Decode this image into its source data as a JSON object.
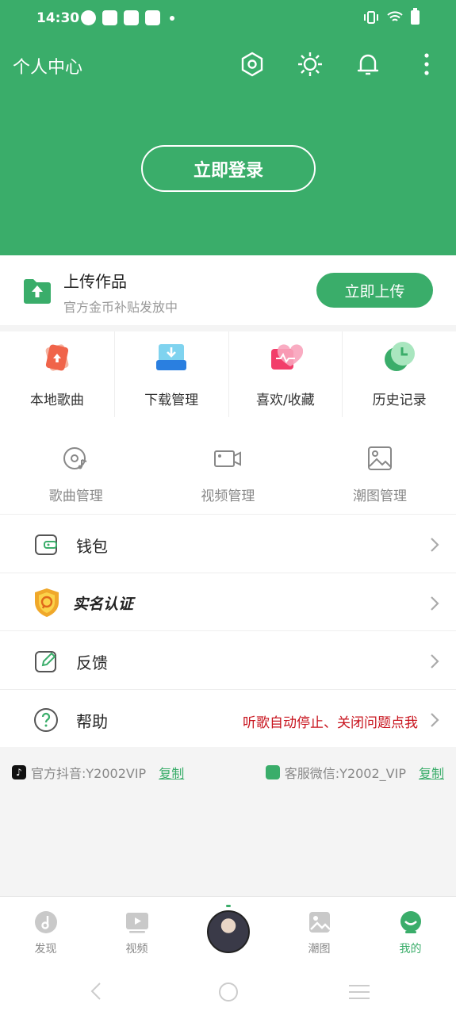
{
  "status": {
    "time": "14:30"
  },
  "header": {
    "title": "个人中心",
    "login_label": "立即登录"
  },
  "upload": {
    "title": "上传作品",
    "subtitle": "官方金币补贴发放中",
    "button_label": "立即上传"
  },
  "quick": [
    {
      "label": "本地歌曲",
      "icon": "local-music-icon"
    },
    {
      "label": "下载管理",
      "icon": "download-icon"
    },
    {
      "label": "喜欢/收藏",
      "icon": "heart-icon"
    },
    {
      "label": "历史记录",
      "icon": "clock-icon"
    }
  ],
  "manage": [
    {
      "label": "歌曲管理",
      "icon": "disc-icon"
    },
    {
      "label": "视频管理",
      "icon": "video-camera-icon"
    },
    {
      "label": "潮图管理",
      "icon": "image-icon"
    }
  ],
  "menu": [
    {
      "label": "钱包",
      "icon": "wallet-icon"
    },
    {
      "label": "实名认证",
      "icon": "shield-badge-icon"
    },
    {
      "label": "反馈",
      "icon": "edit-icon"
    },
    {
      "label": "帮助",
      "icon": "help-icon",
      "note": "听歌自动停止、关闭问题点我"
    }
  ],
  "contact": {
    "douyin": "官方抖音:Y2002VIP",
    "wechat": "客服微信:Y2002_VIP",
    "copy_label": "复制"
  },
  "nav": [
    {
      "label": "发现",
      "icon": "discover-icon"
    },
    {
      "label": "视频",
      "icon": "video-icon"
    },
    {
      "label": "",
      "icon": "avatar"
    },
    {
      "label": "潮图",
      "icon": "image-icon"
    },
    {
      "label": "我的",
      "icon": "profile-icon",
      "active": true
    }
  ],
  "colors": {
    "accent": "#3aad6a",
    "alert": "#c8141e"
  }
}
